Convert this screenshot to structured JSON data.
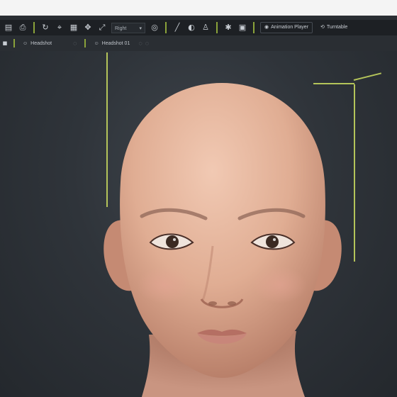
{
  "window": {
    "toolbar": {
      "view_dropdown": {
        "value": "Right"
      },
      "animation_player_label": "Animation Player",
      "turntable_label": "Turntable"
    },
    "tabs": [
      {
        "label": "Headshot"
      },
      {
        "label": "Headshot 01"
      }
    ]
  },
  "viewport": {
    "subject": "head-model",
    "colors": {
      "background": "#2f343a",
      "skin": "#e3b39b",
      "guide_lines": "#b4c45a"
    }
  }
}
